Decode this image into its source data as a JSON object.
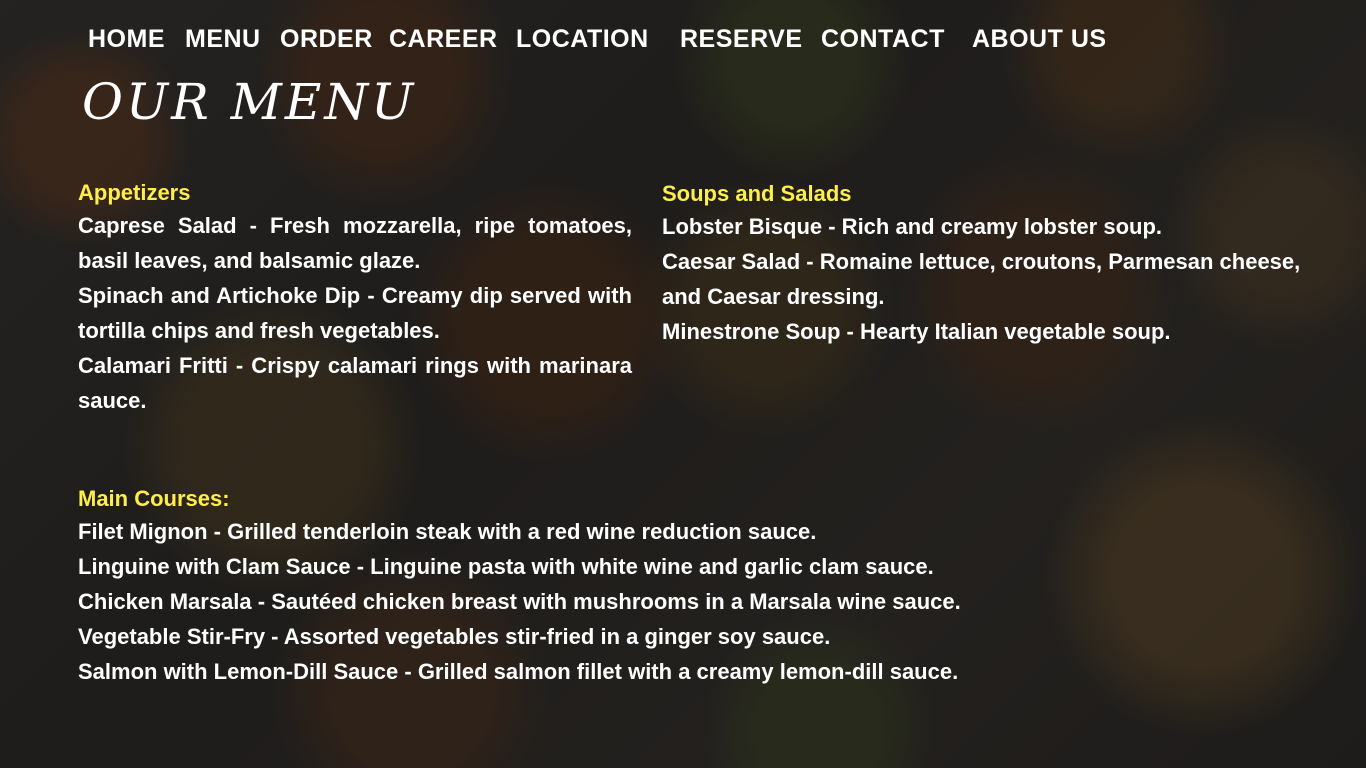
{
  "nav": {
    "items": [
      {
        "label": "HOME"
      },
      {
        "label": "MENU"
      },
      {
        "label": "ORDER"
      },
      {
        "label": "CAREER"
      },
      {
        "label": "LOCATION"
      },
      {
        "label": "RESERVE"
      },
      {
        "label": "CONTACT"
      },
      {
        "label": "ABOUT US"
      }
    ]
  },
  "page_title": "OUR MENU",
  "appetizers": {
    "heading": "Appetizers",
    "items": [
      "Caprese Salad - Fresh mozzarella, ripe tomatoes, basil leaves, and balsamic glaze.",
      "Spinach and Artichoke Dip - Creamy dip served with tortilla chips and fresh vegetables.",
      "Calamari Fritti - Crispy calamari rings with marinara sauce."
    ]
  },
  "soups_salads": {
    "heading": "Soups and Salads",
    "items": [
      "Lobster Bisque - Rich and creamy lobster soup.",
      "Caesar Salad - Romaine lettuce, croutons, Parmesan cheese, and Caesar dressing.",
      "Minestrone Soup - Hearty Italian vegetable soup."
    ]
  },
  "main_courses": {
    "heading": "Main Courses:",
    "items": [
      "Filet Mignon - Grilled tenderloin steak with a red wine reduction sauce.",
      "Linguine with Clam Sauce - Linguine pasta with white wine and garlic clam sauce.",
      "Chicken Marsala - Sautéed chicken breast with mushrooms in a Marsala wine sauce.",
      "Vegetable Stir-Fry - Assorted vegetables stir-fried in a ginger soy sauce.",
      "Salmon with Lemon-Dill Sauce - Grilled salmon fillet with a creamy lemon-dill sauce."
    ]
  },
  "colors": {
    "heading_accent": "#ffee4a",
    "text": "#ffffff"
  }
}
